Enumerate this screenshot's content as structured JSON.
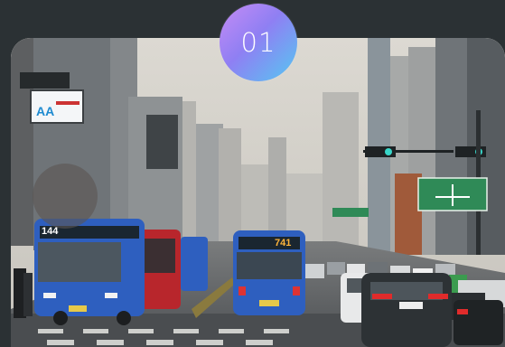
{
  "badge": {
    "label": "01"
  },
  "scene": {
    "bus_left_route": "144",
    "bus_center_route": "741",
    "colors": {
      "sky": "#d9d6cf",
      "road": "#5a5d60",
      "bus_blue": "#2e5fbf",
      "bus_red": "#b8262c",
      "sign_green": "#2f8a57",
      "background": "#2b3134"
    }
  }
}
